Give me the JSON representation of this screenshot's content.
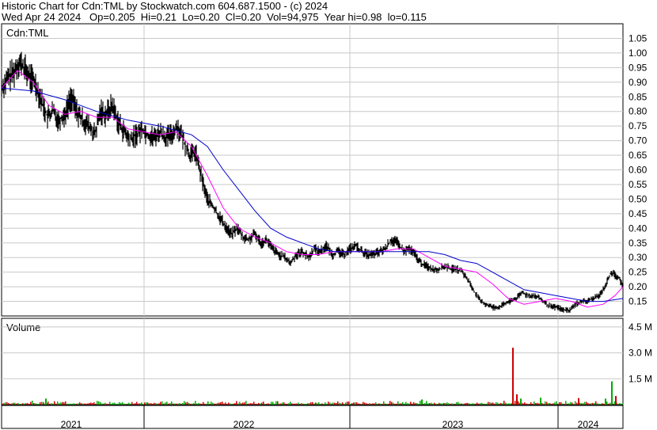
{
  "header": {
    "line1": "Historic Chart for Cdn:TML by Stockwatch.com 604.687.1500 - (c) 2024",
    "line2": "Wed Apr 24 2024   Op=0.205  Hi=0.21  Lo=0.20  Cl=0.20  Vol=94,975  Year hi=0.98  lo=0.115"
  },
  "chart_data": [
    {
      "type": "line",
      "panel_label": "Cdn:TML",
      "ylim": [
        0.1,
        1.1
      ],
      "y_ticks": [
        "1.05",
        "1.00",
        "0.95",
        "0.90",
        "0.85",
        "0.80",
        "0.75",
        "0.70",
        "0.65",
        "0.60",
        "0.55",
        "0.50",
        "0.45",
        "0.40",
        "0.35",
        "0.30",
        "0.25",
        "0.20",
        "0.15"
      ],
      "x_labels": [
        "2021",
        "2022",
        "2023",
        "2024"
      ],
      "grid": true,
      "series": [
        {
          "key": "price",
          "color": "#000000",
          "x": [
            0,
            5,
            10,
            15,
            22,
            28,
            35,
            42,
            50,
            58,
            65,
            72,
            80,
            88,
            95,
            102,
            110,
            118,
            125,
            132,
            140,
            148,
            155,
            162,
            170,
            178,
            185,
            192,
            200,
            208,
            215,
            222,
            230,
            238,
            245,
            252,
            260,
            268,
            275,
            282,
            290,
            298,
            305,
            312,
            320,
            328,
            335,
            342,
            350,
            358,
            365,
            372,
            380,
            388,
            395,
            402,
            410,
            418,
            425,
            432,
            440,
            448,
            455,
            462,
            470,
            478,
            485,
            492,
            500,
            508,
            515,
            522,
            530,
            538,
            545,
            552,
            560,
            568,
            575,
            582,
            590,
            598,
            605,
            612,
            620,
            628,
            635,
            642,
            650,
            658,
            665,
            672,
            680,
            688,
            695,
            702,
            710,
            718,
            725,
            732,
            740,
            748,
            755,
            762,
            770,
            775,
            780,
            785
          ],
          "y": [
            0.88,
            0.9,
            0.92,
            0.93,
            0.97,
            0.95,
            0.92,
            0.9,
            0.84,
            0.78,
            0.8,
            0.77,
            0.79,
            0.85,
            0.8,
            0.77,
            0.75,
            0.72,
            0.8,
            0.79,
            0.82,
            0.76,
            0.73,
            0.7,
            0.72,
            0.74,
            0.72,
            0.71,
            0.73,
            0.71,
            0.72,
            0.75,
            0.7,
            0.65,
            0.66,
            0.58,
            0.5,
            0.47,
            0.44,
            0.41,
            0.38,
            0.4,
            0.37,
            0.36,
            0.38,
            0.35,
            0.36,
            0.33,
            0.31,
            0.3,
            0.28,
            0.31,
            0.32,
            0.3,
            0.33,
            0.32,
            0.34,
            0.31,
            0.32,
            0.31,
            0.33,
            0.34,
            0.32,
            0.31,
            0.31,
            0.32,
            0.33,
            0.36,
            0.35,
            0.32,
            0.33,
            0.31,
            0.28,
            0.27,
            0.26,
            0.26,
            0.27,
            0.26,
            0.26,
            0.25,
            0.22,
            0.18,
            0.15,
            0.14,
            0.13,
            0.13,
            0.14,
            0.15,
            0.16,
            0.18,
            0.17,
            0.17,
            0.16,
            0.14,
            0.13,
            0.13,
            0.12,
            0.12,
            0.14,
            0.15,
            0.15,
            0.16,
            0.17,
            0.2,
            0.25,
            0.24,
            0.23,
            0.2
          ]
        },
        {
          "key": "ma_short",
          "color": "#ff00ff",
          "x": [
            0,
            20,
            40,
            60,
            80,
            100,
            120,
            140,
            160,
            180,
            200,
            220,
            240,
            260,
            280,
            300,
            320,
            340,
            360,
            380,
            400,
            420,
            440,
            460,
            480,
            500,
            520,
            540,
            560,
            580,
            600,
            620,
            640,
            660,
            680,
            700,
            720,
            740,
            760,
            775,
            785
          ],
          "y": [
            0.88,
            0.94,
            0.9,
            0.82,
            0.79,
            0.8,
            0.78,
            0.78,
            0.74,
            0.73,
            0.72,
            0.73,
            0.68,
            0.58,
            0.47,
            0.4,
            0.37,
            0.35,
            0.32,
            0.31,
            0.31,
            0.32,
            0.32,
            0.32,
            0.32,
            0.33,
            0.33,
            0.3,
            0.27,
            0.26,
            0.25,
            0.21,
            0.16,
            0.14,
            0.15,
            0.16,
            0.15,
            0.13,
            0.14,
            0.17,
            0.2
          ]
        },
        {
          "key": "ma_long",
          "color": "#0000cc",
          "x": [
            0,
            40,
            80,
            120,
            160,
            200,
            240,
            260,
            280,
            300,
            320,
            340,
            360,
            380,
            400,
            420,
            440,
            460,
            480,
            500,
            520,
            540,
            560,
            580,
            600,
            620,
            640,
            660,
            680,
            700,
            720,
            740,
            760,
            785
          ],
          "y": [
            0.88,
            0.87,
            0.84,
            0.8,
            0.77,
            0.75,
            0.72,
            0.68,
            0.6,
            0.53,
            0.46,
            0.4,
            0.37,
            0.35,
            0.33,
            0.32,
            0.32,
            0.32,
            0.32,
            0.32,
            0.32,
            0.32,
            0.31,
            0.29,
            0.28,
            0.25,
            0.22,
            0.19,
            0.18,
            0.17,
            0.16,
            0.15,
            0.15,
            0.16
          ]
        }
      ]
    },
    {
      "type": "bar",
      "panel_label": "Volume",
      "ylim": [
        0,
        5000000
      ],
      "y_ticks": [
        "4.5 M",
        "3.0 M",
        "1.5 M"
      ],
      "spikes": [
        {
          "x": 645,
          "value": 3300000,
          "color": "#cc0000"
        },
        {
          "x": 770,
          "value": 1350000,
          "color": "#00aa00"
        },
        {
          "x": 650,
          "value": 600000,
          "color": "#cc0000"
        },
        {
          "x": 655,
          "value": 350000,
          "color": "#00aa00"
        },
        {
          "x": 680,
          "value": 400000,
          "color": "#00aa00"
        },
        {
          "x": 762,
          "value": 350000,
          "color": "#00aa00"
        },
        {
          "x": 775,
          "value": 500000,
          "color": "#cc0000"
        },
        {
          "x": 55,
          "value": 350000,
          "color": "#00aa00"
        },
        {
          "x": 530,
          "value": 300000,
          "color": "#00aa00"
        },
        {
          "x": 728,
          "value": 380000,
          "color": "#cc0000"
        }
      ]
    }
  ],
  "colors": {
    "up": "#00aa00",
    "down": "#cc0000",
    "grid": "#c8c8c8"
  }
}
